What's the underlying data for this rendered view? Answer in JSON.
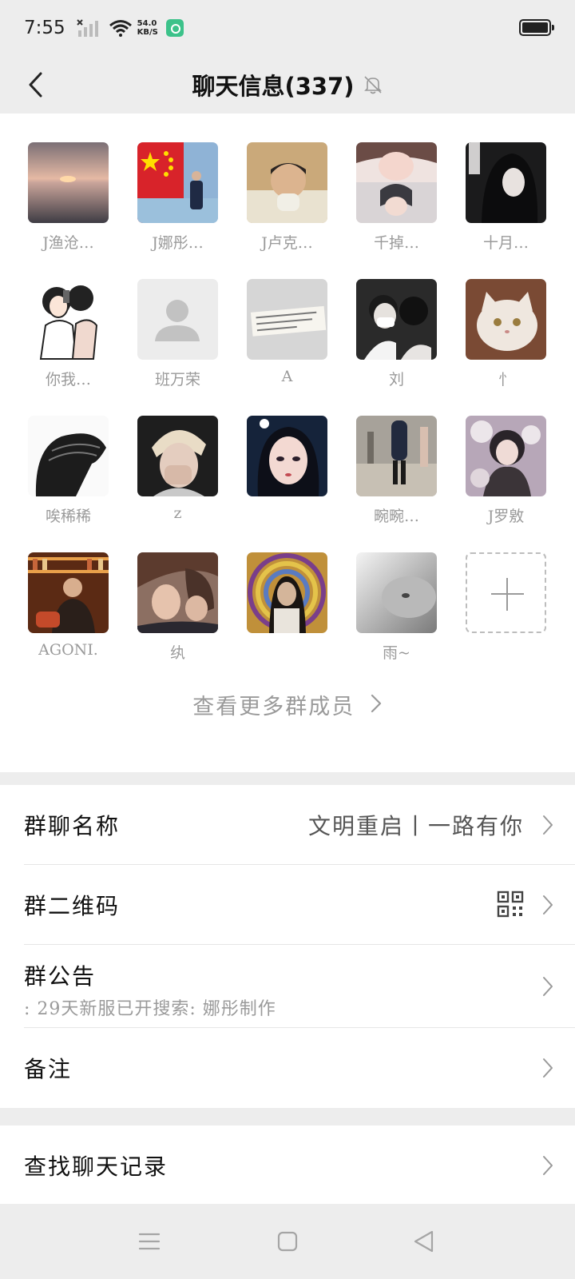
{
  "status_bar": {
    "time": "7:55",
    "net_speed_value": "54.0",
    "net_speed_unit": "KB/S"
  },
  "nav": {
    "title": "聊天信息(337)"
  },
  "members": [
    {
      "name": "J渔沧…",
      "avatar": "sunset-sea"
    },
    {
      "name": "J娜彤…",
      "avatar": "flag-beach"
    },
    {
      "name": "J卢克…",
      "avatar": "boy-selfie"
    },
    {
      "name": "千掉…",
      "avatar": "anime-girls"
    },
    {
      "name": "十月…",
      "avatar": "hooded-figure"
    },
    {
      "name": "你我…",
      "avatar": "couple-sketch"
    },
    {
      "name": "班万荣",
      "avatar": "default-person"
    },
    {
      "name": "A",
      "avatar": "note-paper"
    },
    {
      "name": "刘",
      "avatar": "masked-couple"
    },
    {
      "name": "忄",
      "avatar": "white-cat"
    },
    {
      "name": "唉稀稀",
      "avatar": "bw-hair"
    },
    {
      "name": "z",
      "avatar": "blond-hand"
    },
    {
      "name": "",
      "avatar": "anime-woman"
    },
    {
      "name": "畹畹…",
      "avatar": "street-walk"
    },
    {
      "name": "J罗敫",
      "avatar": "girl-plushies"
    },
    {
      "name": "AGONI.",
      "avatar": "bar-photo"
    },
    {
      "name": "纨",
      "avatar": "anime-kiss"
    },
    {
      "name": "",
      "avatar": "psychedelic-man"
    },
    {
      "name": "雨~",
      "avatar": "gray-cat"
    }
  ],
  "view_more": "查看更多群成员",
  "settings": {
    "group_name_label": "群聊名称",
    "group_name_value": "文明重启丨一路有你",
    "qr_label": "群二维码",
    "notice_label": "群公告",
    "notice_preview": ": 29天新服已开搜索: 娜彤制作",
    "remark_label": "备注",
    "search_history_label": "查找聊天记录"
  }
}
